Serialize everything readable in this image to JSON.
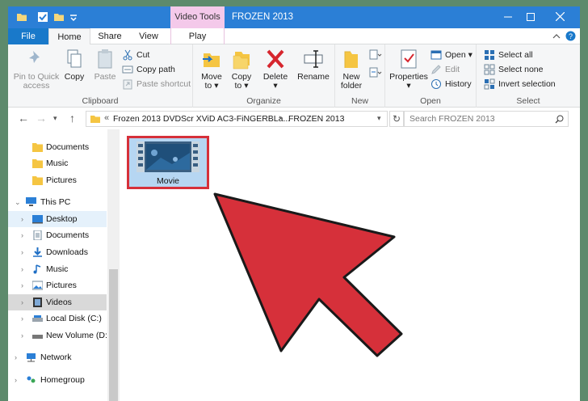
{
  "window": {
    "context_tab": "Video Tools",
    "title": "FROZEN 2013"
  },
  "tabs": {
    "file": "File",
    "home": "Home",
    "share": "Share",
    "view": "View",
    "play": "Play"
  },
  "ribbon": {
    "clipboard": {
      "label": "Clipboard",
      "pin_line1": "Pin to Quick",
      "pin_line2": "access",
      "copy": "Copy",
      "paste": "Paste",
      "cut": "Cut",
      "copy_path": "Copy path",
      "paste_shortcut": "Paste shortcut"
    },
    "organize": {
      "label": "Organize",
      "move_to_line1": "Move",
      "move_to_line2": "to ▾",
      "copy_to_line1": "Copy",
      "copy_to_line2": "to ▾",
      "delete": "Delete",
      "delete_arrow": "▾",
      "rename": "Rename"
    },
    "new": {
      "label": "New",
      "new_folder_line1": "New",
      "new_folder_line2": "folder"
    },
    "open": {
      "label": "Open",
      "properties": "Properties",
      "properties_arrow": "▾",
      "open": "Open ▾",
      "edit": "Edit",
      "history": "History"
    },
    "select": {
      "label": "Select",
      "select_all": "Select all",
      "select_none": "Select none",
      "invert": "Invert selection"
    }
  },
  "address": {
    "prefix": "«",
    "crumb_parent": "Frozen 2013 DVDScr XViD AC3-FiNGERBLa...",
    "separator": "›",
    "crumb_current": "FROZEN 2013",
    "search_placeholder": "Search FROZEN 2013"
  },
  "nav": {
    "items": [
      {
        "label": "Documents"
      },
      {
        "label": "Music"
      },
      {
        "label": "Pictures"
      },
      {
        "label": "This PC"
      },
      {
        "label": "Desktop"
      },
      {
        "label": "Documents"
      },
      {
        "label": "Downloads"
      },
      {
        "label": "Music"
      },
      {
        "label": "Pictures"
      },
      {
        "label": "Videos"
      },
      {
        "label": "Local Disk (C:)"
      },
      {
        "label": "New Volume (D:)"
      },
      {
        "label": "Network"
      },
      {
        "label": "Homegroup"
      }
    ]
  },
  "files": [
    {
      "name": "Movie",
      "icon": "video-file-icon"
    }
  ],
  "colors": {
    "titlebar": "#2b7fd6",
    "video_tools": "#f4c9ea",
    "arrow": "#d6303a",
    "selection": "#cce8ff"
  }
}
